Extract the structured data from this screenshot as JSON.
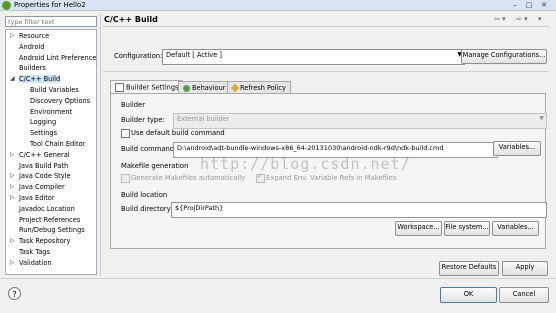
{
  "window": {
    "title": "Properties for Hello2"
  },
  "filter": {
    "placeholder": "type filter text"
  },
  "tree": {
    "items": [
      {
        "label": "Resource",
        "arrow": "▷",
        "selected": false
      },
      {
        "label": "Android",
        "arrow": "",
        "selected": false
      },
      {
        "label": "Android Lint Preferences",
        "arrow": "",
        "selected": false
      },
      {
        "label": "Builders",
        "arrow": "",
        "selected": false
      },
      {
        "label": "C/C++ Build",
        "arrow": "◢",
        "selected": true
      },
      {
        "label": "Build Variables",
        "arrow": "",
        "selected": false
      },
      {
        "label": "Discovery Options",
        "arrow": "",
        "selected": false
      },
      {
        "label": "Environment",
        "arrow": "",
        "selected": false
      },
      {
        "label": "Logging",
        "arrow": "",
        "selected": false
      },
      {
        "label": "Settings",
        "arrow": "",
        "selected": false
      },
      {
        "label": "Tool Chain Editor",
        "arrow": "",
        "selected": false
      },
      {
        "label": "C/C++ General",
        "arrow": "▷",
        "selected": false
      },
      {
        "label": "Java Build Path",
        "arrow": "",
        "selected": false
      },
      {
        "label": "Java Code Style",
        "arrow": "▷",
        "selected": false
      },
      {
        "label": "Java Compiler",
        "arrow": "▷",
        "selected": false
      },
      {
        "label": "Java Editor",
        "arrow": "▷",
        "selected": false
      },
      {
        "label": "Javadoc Location",
        "arrow": "",
        "selected": false
      },
      {
        "label": "Project References",
        "arrow": "",
        "selected": false
      },
      {
        "label": "Run/Debug Settings",
        "arrow": "",
        "selected": false
      },
      {
        "label": "Task Repository",
        "arrow": "▷",
        "selected": false
      },
      {
        "label": "Task Tags",
        "arrow": "",
        "selected": false
      },
      {
        "label": "Validation",
        "arrow": "▷",
        "selected": false
      }
    ]
  },
  "page": {
    "title": "C/C++ Build",
    "configuration_label": "Configuration:",
    "configuration_value": "Default  [ Active ]",
    "manage_button": "Manage Configurations..."
  },
  "tabs": [
    {
      "label": "Builder Settings",
      "icon": "builder-icon",
      "active": true
    },
    {
      "label": "Behaviour",
      "icon": "behaviour-icon",
      "active": false
    },
    {
      "label": "Refresh Policy",
      "icon": "refresh-icon",
      "active": false
    }
  ],
  "builder": {
    "group_label": "Builder",
    "type_label": "Builder type:",
    "type_value": "External builder",
    "use_default_label": "Use default build command",
    "use_default_checked": false,
    "command_label": "Build command:",
    "command_value": "D:\\android\\adt-bundle-windows-x86_64-20131030\\android-ndk-r9d\\ndk-build.cmd",
    "variables_button": "Variables..."
  },
  "makefile": {
    "group_label": "Makefile generation",
    "generate_label": "Generate Makefiles automatically",
    "expand_label": "Expand Env. Variable Refs in Makefiles",
    "expand_checked": true
  },
  "build_location": {
    "group_label": "Build location",
    "dir_label": "Build directory:",
    "dir_value": "${ProjDirPath}",
    "workspace_button": "Workspace...",
    "filesystem_button": "File system...",
    "variables_button": "Variables..."
  },
  "watermark": "http://blog.csdn.net/",
  "footer": {
    "restore_defaults": "Restore Defaults",
    "apply": "Apply",
    "ok": "OK",
    "cancel": "Cancel",
    "help_icon": "?"
  },
  "colors": {
    "selection": "#cde5fb",
    "titlebar": "#d8e4f2"
  }
}
